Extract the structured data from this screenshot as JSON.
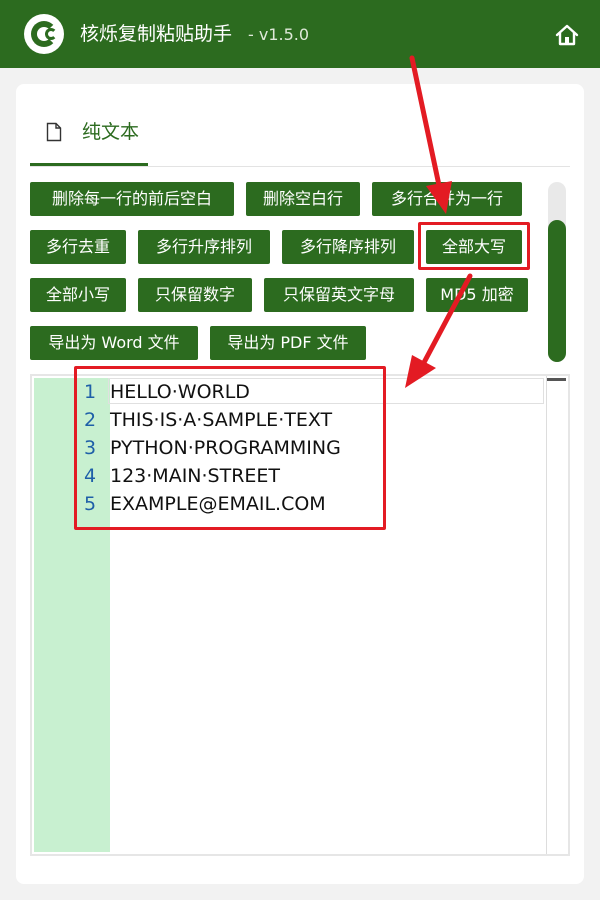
{
  "window": {
    "title": "核烁复制粘贴助手",
    "version": "- v1.5.0",
    "accent_color": "#2c6b1f",
    "home_icon": "home-icon"
  },
  "tabs": [
    {
      "label": "纯文本",
      "icon": "file-icon",
      "active": true
    }
  ],
  "toolbar": {
    "buttons": [
      "删除每一行的前后空白",
      "删除空白行",
      "多行合并为一行",
      "多行去重",
      "多行升序排列",
      "多行降序排列",
      "全部大写",
      "全部小写",
      "只保留数字",
      "只保留英文字母",
      "MD5 加密",
      "导出为 Word 文件",
      "导出为 PDF 文件"
    ],
    "highlighted_button": "全部大写",
    "highlight_color": "#e31b23"
  },
  "editor": {
    "gutter_color": "#c8f0d0",
    "line_number_color": "#1e5fa8",
    "lines": [
      {
        "no": "1",
        "text": "HELLO·WORLD"
      },
      {
        "no": "2",
        "text": "THIS·IS·A·SAMPLE·TEXT"
      },
      {
        "no": "3",
        "text": "PYTHON·PROGRAMMING"
      },
      {
        "no": "4",
        "text": "123·MAIN·STREET"
      },
      {
        "no": "5",
        "text": "EXAMPLE@EMAIL.COM"
      }
    ]
  }
}
